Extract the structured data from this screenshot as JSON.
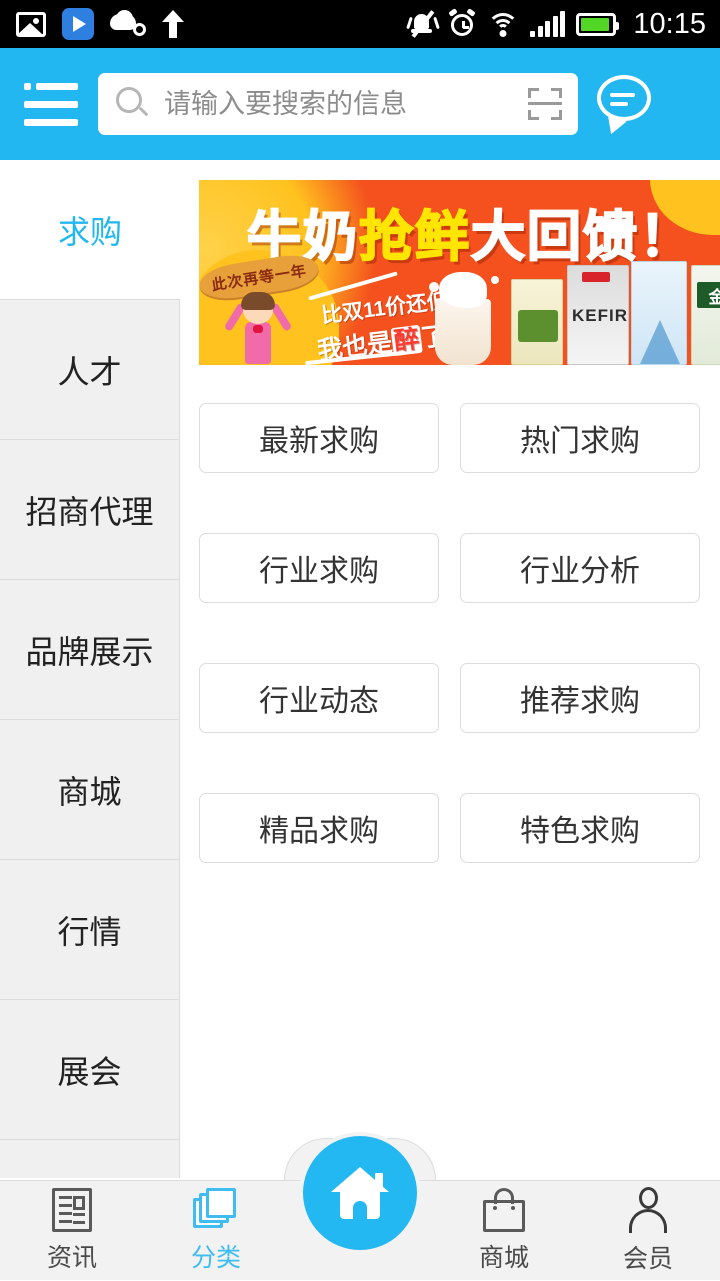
{
  "status_bar": {
    "time": "10:15",
    "left_icons": [
      "image-icon",
      "play-icon",
      "cloud-icon",
      "upload-arrow-icon"
    ],
    "right_icons": [
      "mute-vibrate-icon",
      "alarm-clock-icon",
      "wifi-icon",
      "signal-icon",
      "battery-icon"
    ],
    "battery_color": "#52D726"
  },
  "header": {
    "background": "#22B7F0",
    "menu_icon": "hamburger-list-icon",
    "search": {
      "placeholder": "请输入要搜索的信息",
      "value": "",
      "search_icon": "search-icon",
      "scan_icon": "scan-qr-icon"
    },
    "chat_icon": "chat-bubble-icon"
  },
  "sidebar": {
    "active_color": "#22B7F0",
    "items": [
      {
        "label": "求购",
        "active": true
      },
      {
        "label": "人才",
        "active": false
      },
      {
        "label": "招商代理",
        "active": false
      },
      {
        "label": "品牌展示",
        "active": false
      },
      {
        "label": "商城",
        "active": false
      },
      {
        "label": "行情",
        "active": false
      },
      {
        "label": "展会",
        "active": false
      },
      {
        "label": "",
        "active": false
      }
    ]
  },
  "banner": {
    "title_part1": "牛奶",
    "title_highlight": "抢鲜",
    "title_part2": "大回馈！",
    "ribbon": "此次再等一年",
    "sub1": "比双11价还低",
    "sub2_a": "我也是",
    "sub2_red": "醉",
    "sub2_b": "了！",
    "pack_label_kefir": "KEFIR",
    "pack_label_gold": "金",
    "colors": {
      "bg": "#F4511E",
      "accent": "#FFC21E",
      "highlight": "#FFE500"
    }
  },
  "grid": {
    "buttons": [
      {
        "label": "最新求购"
      },
      {
        "label": "热门求购"
      },
      {
        "label": "行业求购"
      },
      {
        "label": "行业分析"
      },
      {
        "label": "行业动态"
      },
      {
        "label": "推荐求购"
      },
      {
        "label": "精品求购"
      },
      {
        "label": "特色求购"
      }
    ]
  },
  "tabbar": {
    "active_color": "#3FBDF1",
    "items": [
      {
        "label": "资讯",
        "icon": "news-icon",
        "active": false
      },
      {
        "label": "分类",
        "icon": "layers-icon",
        "active": true
      },
      {
        "label": "",
        "icon": "home-icon",
        "active": false
      },
      {
        "label": "商城",
        "icon": "shopping-bag-icon",
        "active": false
      },
      {
        "label": "会员",
        "icon": "user-icon",
        "active": false
      }
    ],
    "home_button_color": "#23B8F2"
  }
}
